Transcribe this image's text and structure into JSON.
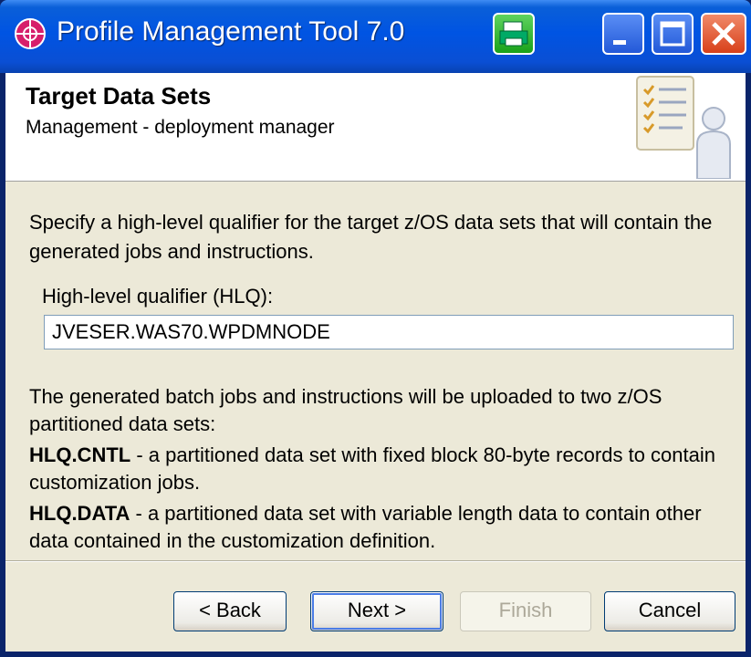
{
  "window": {
    "title": "Profile Management Tool 7.0"
  },
  "header": {
    "title": "Target Data Sets",
    "subtitle": "Management - deployment manager"
  },
  "content": {
    "intro": "Specify a high-level qualifier for the target z/OS data sets that will contain the generated jobs and instructions.",
    "hlq_label": "High-level qualifier (HLQ):",
    "hlq_value": "JVESER.WAS70.WPDMNODE",
    "upload_text": "The generated batch jobs and instructions will be uploaded to two z/OS partitioned data sets:",
    "cntl": {
      "name": "HLQ.CNTL",
      "desc": " - a partitioned data set with fixed block 80-byte records to contain customization jobs."
    },
    "data": {
      "name": "HLQ.DATA",
      "desc": " - a partitioned data set with variable length data to contain other data contained in the customization definition."
    }
  },
  "buttons": {
    "back": "< Back",
    "next": "Next >",
    "finish": "Finish",
    "cancel": "Cancel"
  },
  "icons": [
    "app-icon",
    "print-icon",
    "minimize-icon",
    "maximize-icon",
    "close-icon",
    "checklist-person-icon"
  ]
}
